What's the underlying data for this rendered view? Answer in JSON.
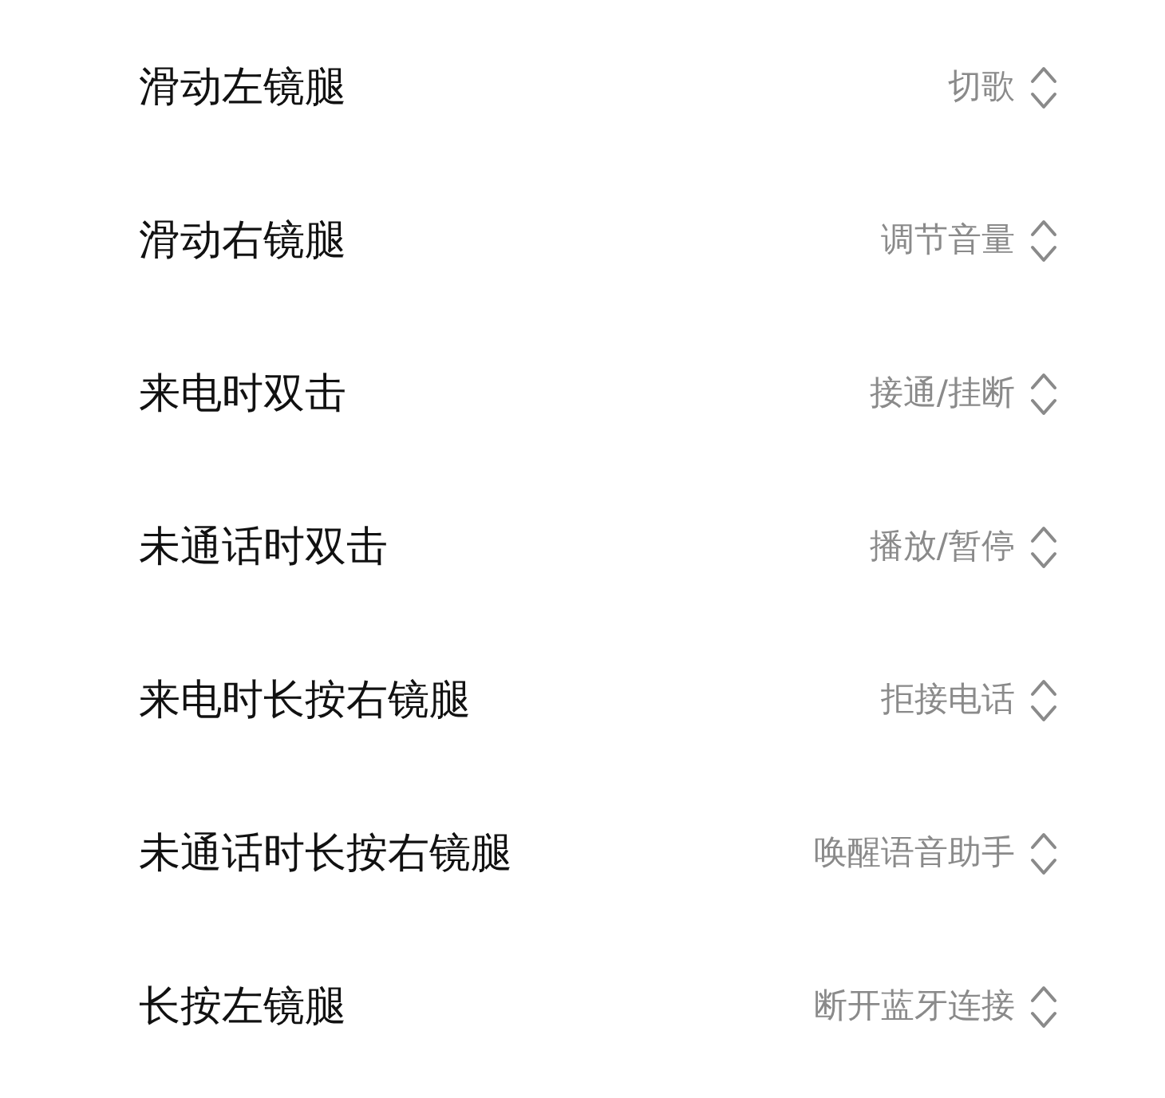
{
  "settings": [
    {
      "label": "滑动左镜腿",
      "value": "切歌"
    },
    {
      "label": "滑动右镜腿",
      "value": "调节音量"
    },
    {
      "label": "来电时双击",
      "value": "接通/挂断"
    },
    {
      "label": "未通话时双击",
      "value": "播放/暂停"
    },
    {
      "label": "来电时长按右镜腿",
      "value": "拒接电话"
    },
    {
      "label": "未通话时长按右镜腿",
      "value": "唤醒语音助手"
    },
    {
      "label": "长按左镜腿",
      "value": "断开蓝牙连接"
    }
  ]
}
